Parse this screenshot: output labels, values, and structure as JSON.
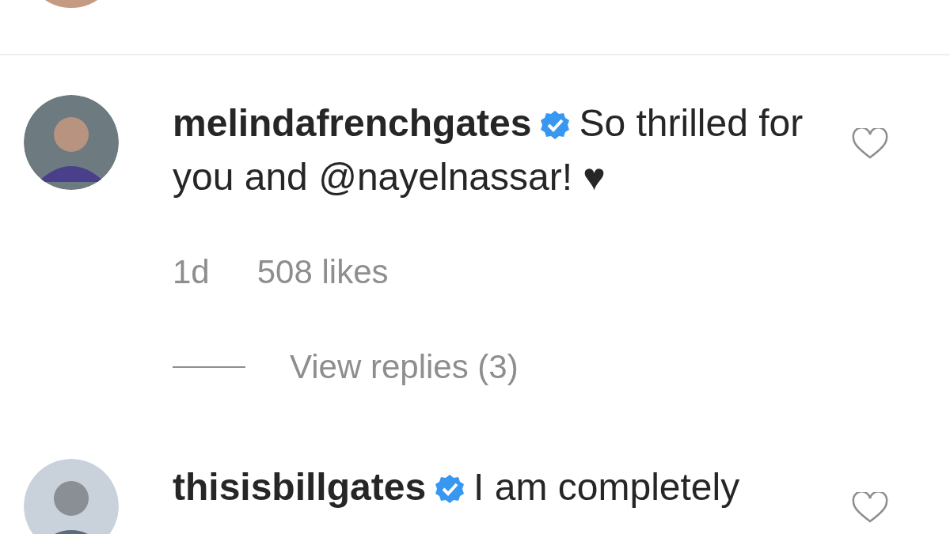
{
  "comments": [
    {
      "username": "melindafrenchgates",
      "verified": true,
      "text": "So thrilled for you and @nayelnassar! ♥",
      "liked": false,
      "time": "1d",
      "likes": "508 likes",
      "replies": "View replies (3)"
    },
    {
      "username": "thisisbillgates",
      "verified": true,
      "text": "I am completely",
      "liked": false
    }
  ]
}
